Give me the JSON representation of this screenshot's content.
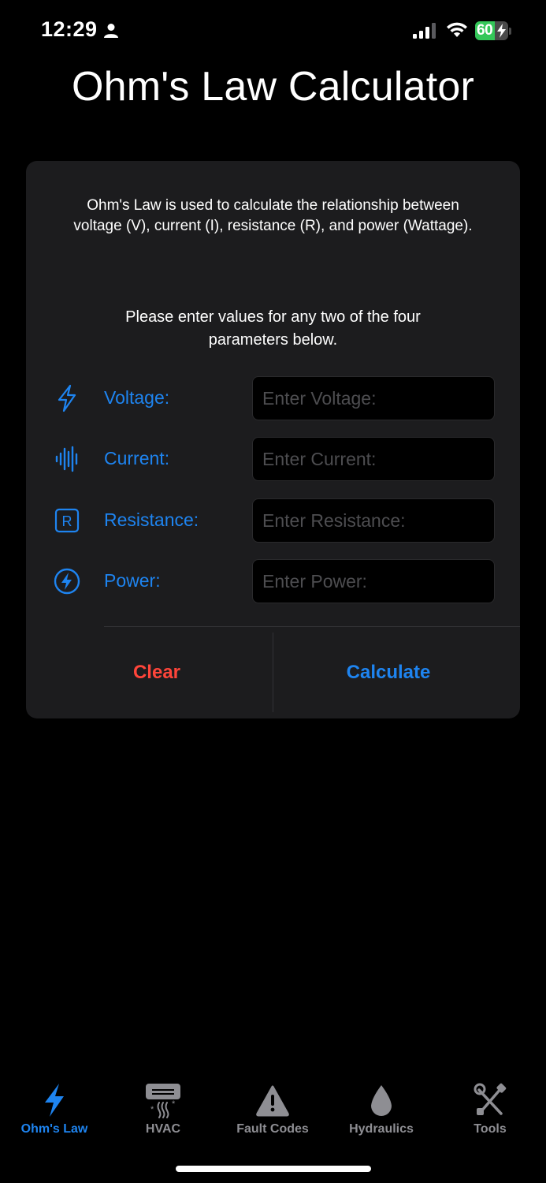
{
  "status_bar": {
    "time": "12:29",
    "battery_level": "60",
    "battery_percent": 60,
    "icons": [
      "person-icon",
      "signal-icon",
      "wifi-icon",
      "battery-charging-icon"
    ]
  },
  "title": "Ohm's Law Calculator",
  "card": {
    "intro": "Ohm's Law is used to calculate the relationship between voltage (V), current (I), resistance (R), and power (Wattage).",
    "instructions": "Please enter values for any two of the four parameters below.",
    "params": [
      {
        "label": "Voltage:",
        "placeholder": "Enter Voltage:",
        "value": "",
        "icon": "bolt-icon"
      },
      {
        "label": "Current:",
        "placeholder": "Enter Current:",
        "value": "",
        "icon": "waveform-icon"
      },
      {
        "label": "Resistance:",
        "placeholder": "Enter Resistance:",
        "value": "",
        "icon": "r-square-icon"
      },
      {
        "label": "Power:",
        "placeholder": "Enter Power:",
        "value": "",
        "icon": "bolt-circle-icon"
      }
    ],
    "clear_label": "Clear",
    "calculate_label": "Calculate"
  },
  "tabs": [
    {
      "label": "Ohm's Law",
      "icon": "bolt-icon",
      "active": true
    },
    {
      "label": "HVAC",
      "icon": "air-conditioner-icon",
      "active": false
    },
    {
      "label": "Fault Codes",
      "icon": "warning-triangle-icon",
      "active": false
    },
    {
      "label": "Hydraulics",
      "icon": "drop-icon",
      "active": false
    },
    {
      "label": "Tools",
      "icon": "wrench-screwdriver-icon",
      "active": false
    }
  ],
  "colors": {
    "accent": "#1e84f0",
    "destructive": "#ff453a",
    "card_bg": "#1c1c1e",
    "inactive_tab": "#8e8e93",
    "battery_green": "#34c759"
  }
}
